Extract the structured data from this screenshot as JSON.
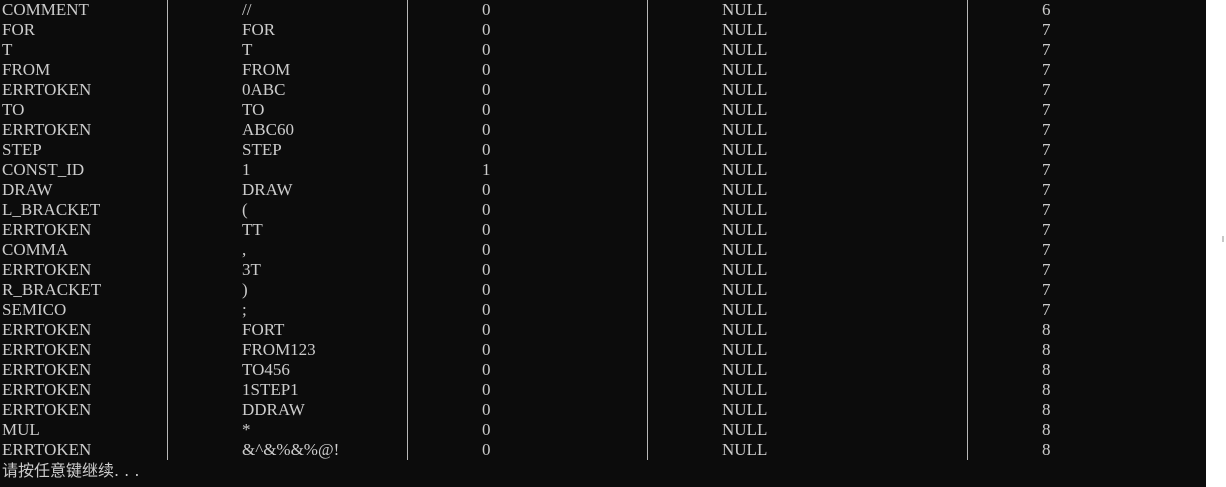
{
  "rows": [
    [
      "COMMENT",
      "//",
      "0",
      "NULL",
      "6"
    ],
    [
      "FOR",
      "FOR",
      "0",
      "NULL",
      "7"
    ],
    [
      "T",
      "T",
      "0",
      "NULL",
      "7"
    ],
    [
      "FROM",
      "FROM",
      "0",
      "NULL",
      "7"
    ],
    [
      "ERRTOKEN",
      "0ABC",
      "0",
      "NULL",
      "7"
    ],
    [
      "TO",
      "TO",
      "0",
      "NULL",
      "7"
    ],
    [
      "ERRTOKEN",
      "ABC60",
      "0",
      "NULL",
      "7"
    ],
    [
      "STEP",
      "STEP",
      "0",
      "NULL",
      "7"
    ],
    [
      "CONST_ID",
      "1",
      "1",
      "NULL",
      "7"
    ],
    [
      "DRAW",
      "DRAW",
      "0",
      "NULL",
      "7"
    ],
    [
      "L_BRACKET",
      "(",
      "0",
      "NULL",
      "7"
    ],
    [
      "ERRTOKEN",
      "TT",
      "0",
      "NULL",
      "7"
    ],
    [
      "COMMA",
      ",",
      "0",
      "NULL",
      "7"
    ],
    [
      "ERRTOKEN",
      "3T",
      "0",
      "NULL",
      "7"
    ],
    [
      "R_BRACKET",
      ")",
      "0",
      "NULL",
      "7"
    ],
    [
      "SEMICO",
      ";",
      "0",
      "NULL",
      "7"
    ],
    [
      "ERRTOKEN",
      "FORT",
      "0",
      "NULL",
      "8"
    ],
    [
      "ERRTOKEN",
      "FROM123",
      "0",
      "NULL",
      "8"
    ],
    [
      "ERRTOKEN",
      "TO456",
      "0",
      "NULL",
      "8"
    ],
    [
      "ERRTOKEN",
      "1STEP1",
      "0",
      "NULL",
      "8"
    ],
    [
      "ERRTOKEN",
      "DDRAW",
      "0",
      "NULL",
      "8"
    ],
    [
      "MUL",
      "*",
      "0",
      "NULL",
      "8"
    ],
    [
      "ERRTOKEN",
      "&^&%&%@!",
      "0",
      "NULL",
      "8"
    ]
  ],
  "prompt": "请按任意键继续. . .",
  "colors": {
    "background": "#0c0c0c",
    "text": "#cccccc",
    "separator": "#b8b8b8",
    "scrollbar": "#ffffff"
  }
}
